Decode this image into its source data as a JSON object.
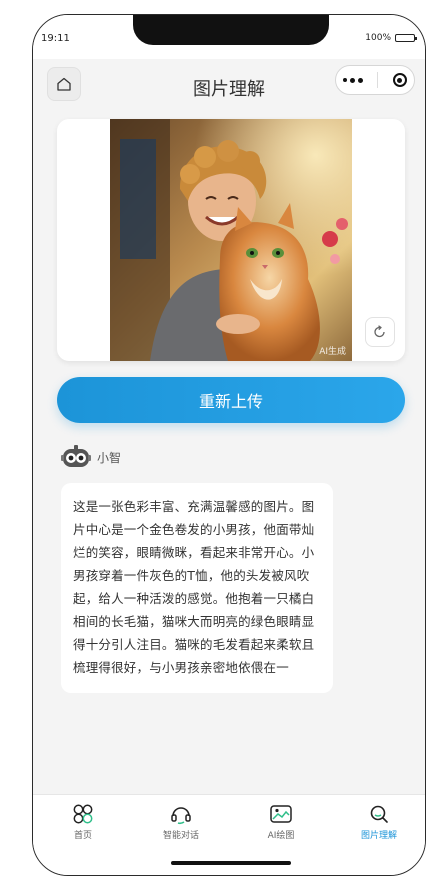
{
  "status_bar": {
    "time": "19:11",
    "battery": "100%"
  },
  "nav": {
    "title": "图片理解"
  },
  "image": {
    "watermark": "AI生成",
    "alt": "boy hugging a ginger cat"
  },
  "upload_button": {
    "label": "重新上传"
  },
  "assistant": {
    "name": "小智"
  },
  "message": {
    "text": "这是一张色彩丰富、充满温馨感的图片。图片中心是一个金色卷发的小男孩，他面带灿烂的笑容，眼睛微眯，看起来非常开心。小男孩穿着一件灰色的T恤，他的头发被风吹起，给人一种活泼的感觉。他抱着一只橘白相间的长毛猫，猫咪大而明亮的绿色眼睛显得十分引人注目。猫咪的毛发看起来柔软且梳理得很好，与小男孩亲密地依偎在一"
  },
  "tabs": [
    {
      "label": "首页",
      "icon": "grid-clover-icon"
    },
    {
      "label": "智能对话",
      "icon": "headset-icon"
    },
    {
      "label": "AI绘图",
      "icon": "picture-icon"
    },
    {
      "label": "图片理解",
      "icon": "search-icon"
    }
  ],
  "colors": {
    "accent": "#1c94d8",
    "background": "#f4f4f4"
  }
}
